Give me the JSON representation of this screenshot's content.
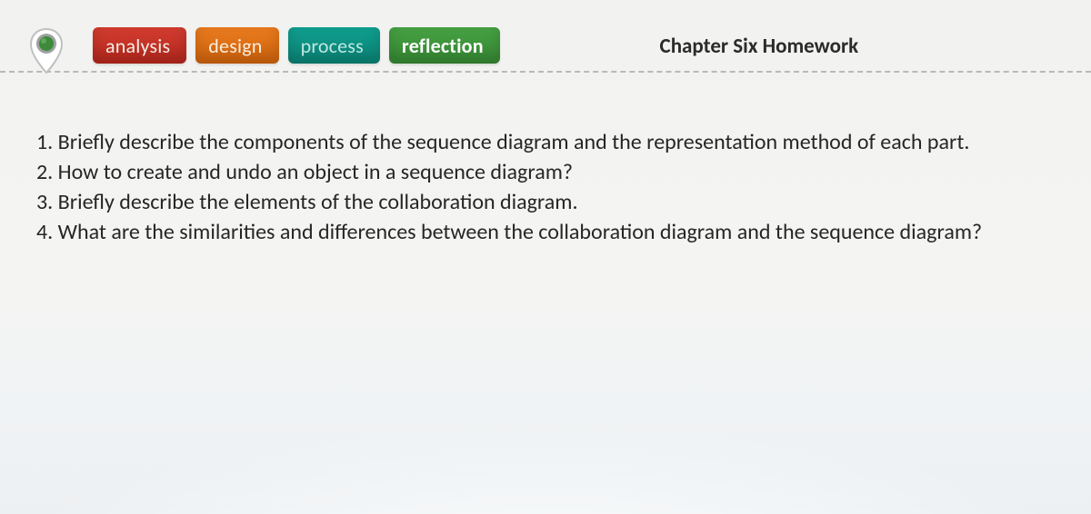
{
  "header": {
    "tabs": [
      {
        "key": "analysis",
        "label": "analysis"
      },
      {
        "key": "design",
        "label": "design"
      },
      {
        "key": "process",
        "label": "process"
      },
      {
        "key": "reflection",
        "label": "reflection"
      }
    ],
    "title": "Chapter Six Homework",
    "marker_color_outer": "#9ea0a1",
    "marker_color_inner": "#3c8a3a"
  },
  "questions": [
    "1. Briefly describe the components of the sequence diagram and the representation method of each part.",
    "2. How to create and undo an object in a sequence diagram?",
    "3. Briefly describe the elements of the collaboration diagram.",
    "4. What are the similarities and differences between the collaboration diagram and the sequence diagram?"
  ]
}
